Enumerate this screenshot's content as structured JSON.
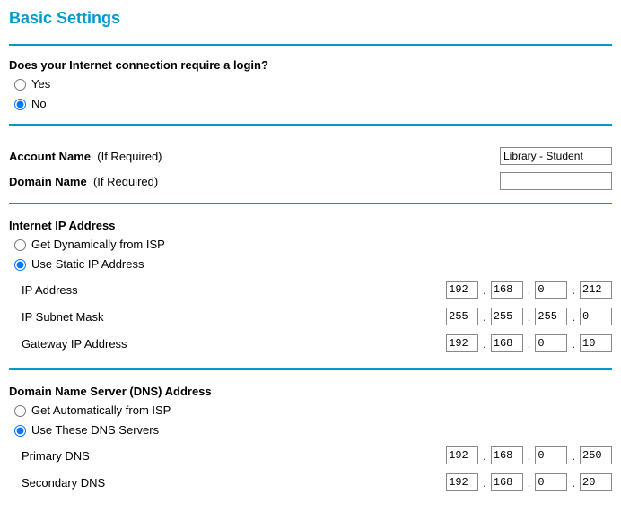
{
  "title": "Basic Settings",
  "login_section": {
    "prompt": "Does your Internet connection require a login?",
    "yes_label": "Yes",
    "no_label": "No",
    "selected": "no"
  },
  "account": {
    "account_name_label": "Account Name",
    "account_name_hint": "(If Required)",
    "account_name_value": "Library - Student",
    "domain_name_label": "Domain Name",
    "domain_name_hint": "(If Required)",
    "domain_name_value": ""
  },
  "internet_ip": {
    "heading": "Internet IP Address",
    "dynamic_label": "Get Dynamically from ISP",
    "static_label": "Use Static IP Address",
    "selected": "static",
    "ip_address_label": "IP Address",
    "ip_address": [
      "192",
      "168",
      "0",
      "212"
    ],
    "subnet_label": "IP Subnet Mask",
    "subnet": [
      "255",
      "255",
      "255",
      "0"
    ],
    "gateway_label": "Gateway IP Address",
    "gateway": [
      "192",
      "168",
      "0",
      "10"
    ]
  },
  "dns": {
    "heading": "Domain Name Server (DNS) Address",
    "auto_label": "Get Automatically from ISP",
    "manual_label": "Use These DNS Servers",
    "selected": "manual",
    "primary_label": "Primary DNS",
    "primary": [
      "192",
      "168",
      "0",
      "250"
    ],
    "secondary_label": "Secondary DNS",
    "secondary": [
      "192",
      "168",
      "0",
      "20"
    ]
  }
}
